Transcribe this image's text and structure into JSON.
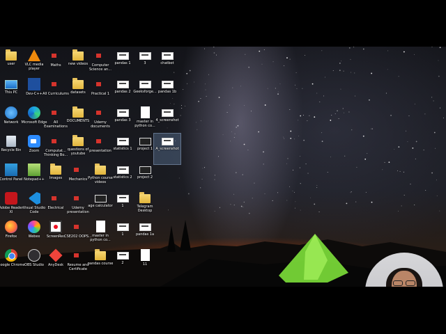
{
  "desktop": {
    "icons": [
      {
        "label": "user",
        "type": "folder"
      },
      {
        "label": "VLC media player",
        "type": "vlc"
      },
      {
        "label": "Maths",
        "type": "docred"
      },
      {
        "label": "new videos",
        "type": "folder"
      },
      {
        "label": "Computer Science an...",
        "type": "docred"
      },
      {
        "label": "pandas 1",
        "type": "thumb"
      },
      {
        "label": "3",
        "type": "thumb"
      },
      {
        "label": "chatbot",
        "type": "thumb"
      },
      {
        "label": "This PC",
        "type": "pc"
      },
      {
        "label": "Dev-C++",
        "type": "devcpp"
      },
      {
        "label": "All Curriculums",
        "type": "docred"
      },
      {
        "label": "datasets",
        "type": "folder"
      },
      {
        "label": "Practical 1",
        "type": "docred"
      },
      {
        "label": "pandas 2",
        "type": "thumb"
      },
      {
        "label": "Geeksforge...",
        "type": "thumb"
      },
      {
        "label": "pandas 1b",
        "type": "thumb"
      },
      {
        "label": "Network",
        "type": "net"
      },
      {
        "label": "Microsoft Edge",
        "type": "edge"
      },
      {
        "label": "All Examinations",
        "type": "docred"
      },
      {
        "label": "DOCUMENTS",
        "type": "folder"
      },
      {
        "label": "Udemy documents",
        "type": "docred"
      },
      {
        "label": "pandas 3",
        "type": "thumb"
      },
      {
        "label": "master in python co...",
        "type": "doc"
      },
      {
        "label": "4_screenshot",
        "type": "thumb"
      },
      {
        "label": "Recycle Bin",
        "type": "bin"
      },
      {
        "label": "Zoom",
        "type": "zoom"
      },
      {
        "label": "Computat... Thinking Bo...",
        "type": "docred"
      },
      {
        "label": "questions of youtube",
        "type": "folder"
      },
      {
        "label": "presentation",
        "type": "docred"
      },
      {
        "label": "statistics 1",
        "type": "thumb"
      },
      {
        "label": "project 1",
        "type": "black"
      },
      {
        "label": "A_screenshot",
        "type": "thumb",
        "selected": true
      },
      {
        "label": "Control Panel",
        "type": "cp"
      },
      {
        "label": "Notepad++",
        "type": "notepad"
      },
      {
        "label": "Images",
        "type": "folder"
      },
      {
        "label": "Mechanics",
        "type": "docred"
      },
      {
        "label": "Python course videos",
        "type": "folder"
      },
      {
        "label": "statistics 2",
        "type": "thumb"
      },
      {
        "label": "project 2",
        "type": "black"
      },
      {
        "label": "Adobe Reader XI",
        "type": "acrobat"
      },
      {
        "label": "Visual Studio Code",
        "type": "vscode"
      },
      {
        "label": "Electrical",
        "type": "docred"
      },
      {
        "label": "Udemy presentation",
        "type": "docred"
      },
      {
        "label": "age calculator",
        "type": "black"
      },
      {
        "label": "1",
        "type": "thumb"
      },
      {
        "label": "Telegram Desktop",
        "type": "folder"
      },
      {
        "label": "Firefox",
        "type": "firefox"
      },
      {
        "label": "Webex",
        "type": "webex"
      },
      {
        "label": "ScreenRec",
        "type": "screenrec"
      },
      {
        "label": "CSE202 OOPS...",
        "type": "docred"
      },
      {
        "label": "master in python co...",
        "type": "doc"
      },
      {
        "label": "1",
        "type": "thumb"
      },
      {
        "label": "pandas 1a",
        "type": "thumb"
      },
      {
        "label": "Google Chrome",
        "type": "chrome"
      },
      {
        "label": "OBS Studio",
        "type": "obs"
      },
      {
        "label": "AnyDesk",
        "type": "anydesk"
      },
      {
        "label": "Resume and Certificate",
        "type": "docred"
      },
      {
        "label": "pandas course",
        "type": "folder"
      },
      {
        "label": "2",
        "type": "thumb"
      },
      {
        "label": "11",
        "type": "doc"
      }
    ]
  },
  "colors": {
    "horizon_glow": "#ff7a1e",
    "tent": "#7de03a"
  }
}
